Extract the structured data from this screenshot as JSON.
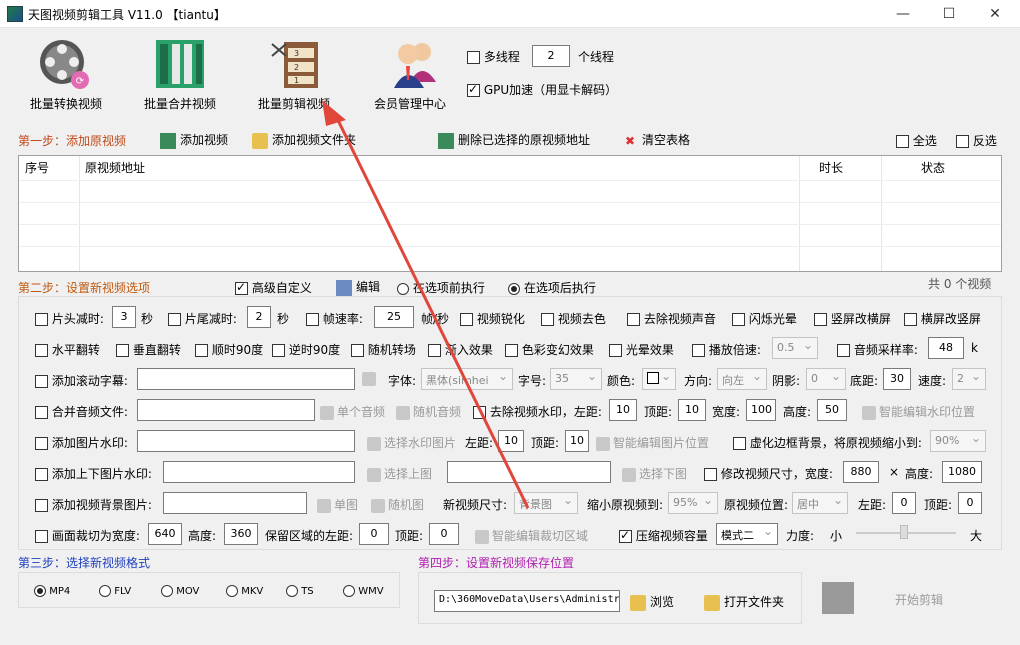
{
  "window": {
    "title": "天图视频剪辑工具 V11.0 【tiantu】",
    "minimize": "—",
    "maximize": "☐",
    "close": "✕"
  },
  "toolbar": {
    "batch_convert": "批量转换视频",
    "batch_merge": "批量合并视频",
    "batch_cut": "批量剪辑视频",
    "member_center": "会员管理中心",
    "multithread_label": "多线程",
    "thread_count": "2",
    "thread_unit": "个线程",
    "gpu_label": "GPU加速（用显卡解码）"
  },
  "step1": {
    "label": "第一步：添加原视频",
    "add_video": "添加视频",
    "add_folder": "添加视频文件夹",
    "delete_selected": "删除已选择的原视频地址",
    "clear_table": "清空表格",
    "select_all": "全选",
    "invert_select": "反选"
  },
  "table": {
    "col_index": "序号",
    "col_path": "原视频地址",
    "col_duration": "时长",
    "col_status": "状态"
  },
  "step2": {
    "label": "第二步：设置新视频选项",
    "advanced": "高级自定义",
    "edit": "编辑",
    "before_exec": "在选项前执行",
    "after_exec": "在选项后执行",
    "count": "共 0 个视频"
  },
  "opts": {
    "head_cut": "片头减时:",
    "head_val": "3",
    "sec": "秒",
    "tail_cut": "片尾减时:",
    "tail_val": "2",
    "fps": "帧速率:",
    "fps_val": "25",
    "fps_unit": "帧/秒",
    "sharpen": "视频锐化",
    "decolor": "视频去色",
    "remove_audio": "去除视频声音",
    "flash": "闪烁光晕",
    "v2h": "竖屏改横屏",
    "h2v": "横屏改竖屏",
    "hflip": "水平翻转",
    "vflip": "垂直翻转",
    "cw90": "顺时90度",
    "ccw90": "逆时90度",
    "rand_trans": "随机转场",
    "fade": "渐入效果",
    "color_fx": "色彩变幻效果",
    "light_fx": "光晕效果",
    "speed": "播放倍速:",
    "speed_val": "0.5",
    "sample": "音频采样率:",
    "sample_val": "48",
    "sample_unit": "k",
    "scroll_sub": "添加滚动字幕:",
    "font": "字体:",
    "font_val": "黑体(simhei",
    "size": "字号:",
    "size_val": "35",
    "color": "颜色:",
    "dir": "方向:",
    "dir_val": "向左",
    "shadow": "阴影:",
    "shadow_val": "0",
    "bottom": "底距:",
    "bottom_val": "30",
    "spd": "速度:",
    "spd_val": "2",
    "merge_audio": "合并音频文件:",
    "single_audio": "单个音频",
    "rand_audio": "随机音频",
    "remove_wm": "去除视频水印，左距:",
    "wm_left": "10",
    "top": "顶距:",
    "wm_top": "10",
    "width": "宽度:",
    "wm_width": "100",
    "height": "高度:",
    "wm_height": "50",
    "smart_wm": "智能编辑水印位置",
    "img_wm": "添加图片水印:",
    "choose_wm": "选择水印图片",
    "left": "左距:",
    "img_left": "10",
    "img_top": "10",
    "smart_img": "智能编辑图片位置",
    "blur_bg": "虚化边框背景，将原视频缩小到:",
    "blur_val": "90%",
    "tb_img": "添加上下图片水印:",
    "choose_top": "选择上图",
    "choose_bottom": "选择下图",
    "resize": "修改视频尺寸，宽度:",
    "resize_w": "880",
    "times": "×",
    "height2": "高度:",
    "resize_h": "1080",
    "bg_img": "添加视频背景图片:",
    "single_img": "单图",
    "rand_img": "随机图",
    "new_size": "新视频尺寸:",
    "new_size_val": "背景图",
    "shrink": "缩小原视频到:",
    "shrink_val": "95%",
    "pos": "原视频位置:",
    "pos_val": "居中",
    "bg_left": "0",
    "bg_top": "0",
    "crop": "画面裁切为宽度:",
    "crop_w": "640",
    "crop_h": "360",
    "keep_left": "保留区域的左距:",
    "crop_left": "0",
    "crop_top": "0",
    "smart_crop": "智能编辑裁切区域",
    "compress": "压缩视频容量",
    "mode_val": "模式二",
    "strength": "力度:",
    "small": "小",
    "big": "大"
  },
  "step3": {
    "label": "第三步：选择新视频格式",
    "formats": [
      "MP4",
      "FLV",
      "MOV",
      "MKV",
      "TS",
      "WMV"
    ]
  },
  "step4": {
    "label": "第四步：设置新视频保存位置",
    "path": "D:\\360MoveData\\Users\\Administr",
    "browse": "浏览",
    "open_folder": "打开文件夹",
    "start": "开始剪辑"
  },
  "colors": {
    "accent_red": "#c04a1a",
    "step_blue": "#2040c0",
    "step_purple": "#b020b0",
    "arrow": "#e0463a"
  }
}
